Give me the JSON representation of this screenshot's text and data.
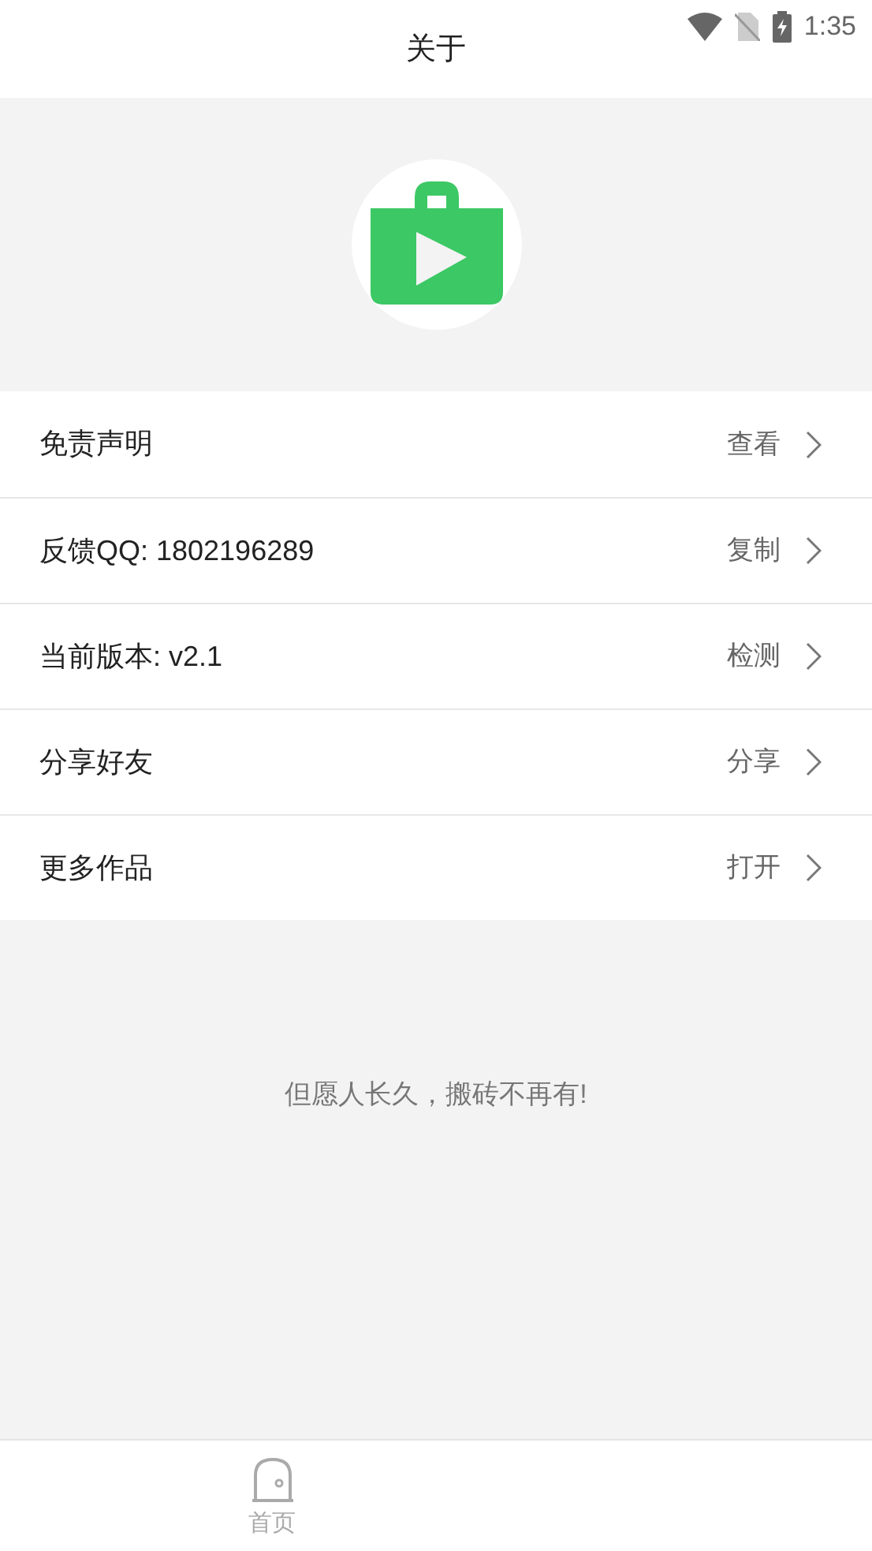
{
  "status_bar": {
    "time": "1:35"
  },
  "header": {
    "title": "关于"
  },
  "rows": [
    {
      "label": "免责声明",
      "action": "查看"
    },
    {
      "label": "反馈QQ: 1802196289",
      "action": "复制"
    },
    {
      "label": "当前版本: v2.1",
      "action": "检测"
    },
    {
      "label": "分享好友",
      "action": "分享"
    },
    {
      "label": "更多作品",
      "action": "打开"
    }
  ],
  "slogan": "但愿人长久，搬砖不再有!",
  "bottom_nav": [
    {
      "label": "首页",
      "selected": false
    }
  ]
}
